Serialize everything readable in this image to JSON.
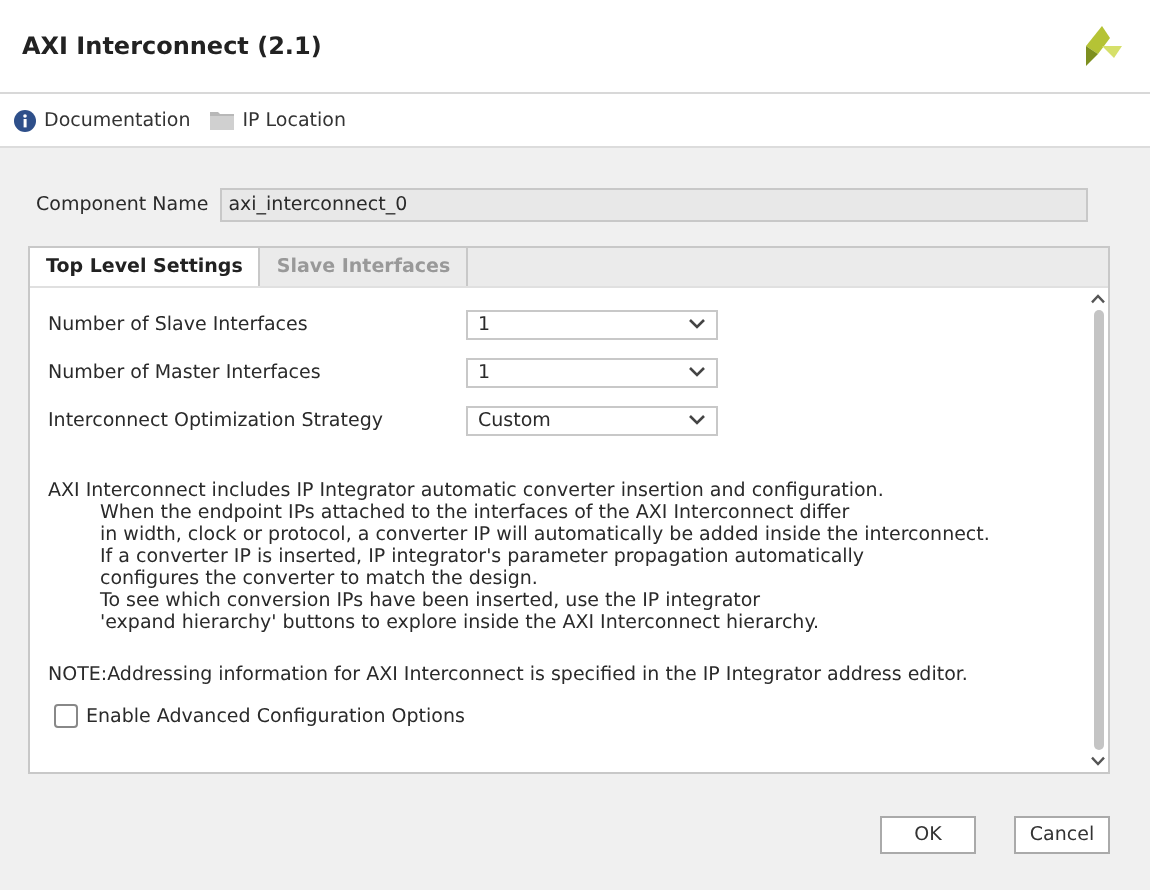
{
  "window": {
    "title": "AXI Interconnect (2.1)"
  },
  "toolbar": [
    {
      "kind": "info",
      "label": "Documentation"
    },
    {
      "kind": "folder",
      "label": "IP Location"
    }
  ],
  "component_name": {
    "label": "Component Name",
    "value": "axi_interconnect_0"
  },
  "tabs": [
    {
      "label": "Top Level Settings",
      "selected": true
    },
    {
      "label": "Slave Interfaces",
      "selected": false
    }
  ],
  "settings": [
    {
      "label": "Number of Slave Interfaces",
      "value": "1"
    },
    {
      "label": "Number of Master Interfaces",
      "value": "1"
    },
    {
      "label": "Interconnect Optimization Strategy",
      "value": "Custom"
    }
  ],
  "description": {
    "heading": "AXI Interconnect includes IP Integrator automatic converter insertion and configuration.",
    "lines": [
      "When the endpoint IPs attached to the interfaces of the AXI Interconnect differ",
      "in width, clock or protocol, a converter IP will automatically be added inside the interconnect.",
      "If a converter IP is inserted, IP integrator's parameter propagation automatically",
      "configures the converter to match the design.",
      "To see which conversion IPs have been inserted, use the IP integrator",
      "'expand hierarchy' buttons to explore inside the AXI Interconnect hierarchy."
    ]
  },
  "note": "NOTE:Addressing information for AXI Interconnect is specified in the IP Integrator address editor.",
  "advanced": {
    "label": "Enable Advanced Configuration Options",
    "checked": false
  },
  "buttons": [
    "OK",
    "Cancel"
  ]
}
